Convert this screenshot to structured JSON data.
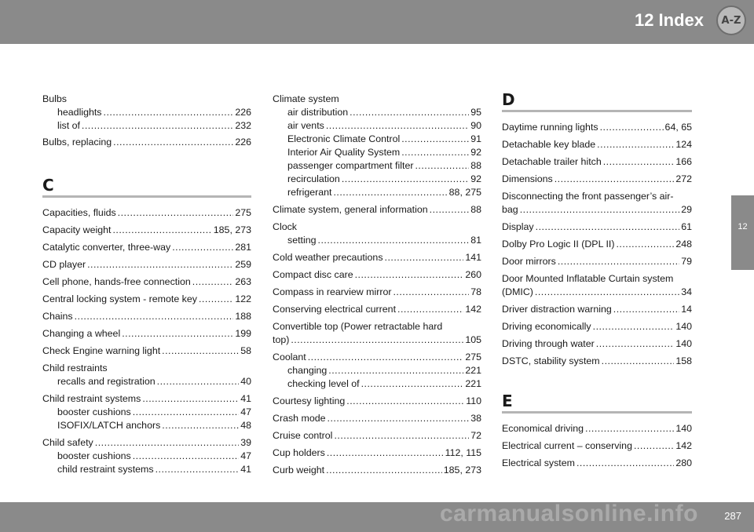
{
  "header": {
    "title": "12 Index",
    "badge": "A-Z"
  },
  "side_tab": "12",
  "footer": {
    "page_number": "287",
    "watermark": "carmanualsonline.info"
  },
  "columns": {
    "col1": {
      "bulbs": {
        "title": "Bulbs",
        "subs": [
          {
            "term": "headlights",
            "pages": "226"
          },
          {
            "term": "list of",
            "pages": "232"
          }
        ]
      },
      "bulbs_replacing": {
        "term": "Bulbs, replacing",
        "pages": "226"
      },
      "letter_c": "C",
      "entries": [
        {
          "term": "Capacities, fluids",
          "pages": "275"
        },
        {
          "term": "Capacity weight",
          "pages": "185, 273"
        },
        {
          "term": "Catalytic converter, three-way",
          "pages": "281"
        },
        {
          "term": "CD player",
          "pages": "259"
        },
        {
          "term": "Cell phone, hands-free connection",
          "pages": "263"
        },
        {
          "term": "Central locking system - remote key",
          "pages": "122"
        },
        {
          "term": "Chains",
          "pages": "188"
        },
        {
          "term": "Changing a wheel",
          "pages": "199"
        },
        {
          "term": "Check Engine warning light",
          "pages": "58"
        }
      ],
      "child_restraints": {
        "title": "Child restraints",
        "subs": [
          {
            "term": "recalls and registration",
            "pages": "40"
          }
        ]
      },
      "child_restraint_systems": {
        "term": "Child restraint systems",
        "pages": "41",
        "subs": [
          {
            "term": "booster cushions",
            "pages": "47"
          },
          {
            "term": "ISOFIX/LATCH anchors",
            "pages": "48"
          }
        ]
      },
      "child_safety": {
        "term": "Child safety",
        "pages": "39",
        "subs": [
          {
            "term": "booster cushions",
            "pages": "47"
          },
          {
            "term": "child restraint systems",
            "pages": "41"
          }
        ]
      }
    },
    "col2": {
      "climate_system": {
        "title": "Climate system",
        "subs": [
          {
            "term": "air distribution",
            "pages": "95"
          },
          {
            "term": "air vents",
            "pages": "90"
          },
          {
            "term": "Electronic Climate Control",
            "pages": "91"
          },
          {
            "term": "Interior Air Quality System",
            "pages": "92"
          },
          {
            "term": "passenger compartment filter",
            "pages": "88"
          },
          {
            "term": "recirculation",
            "pages": "92"
          },
          {
            "term": "refrigerant",
            "pages": "88, 275"
          }
        ]
      },
      "climate_general": {
        "term": "Climate system, general information",
        "pages": "88"
      },
      "clock": {
        "title": "Clock",
        "subs": [
          {
            "term": "setting",
            "pages": "81"
          }
        ]
      },
      "entries_a": [
        {
          "term": "Cold weather precautions",
          "pages": "141"
        },
        {
          "term": "Compact disc care",
          "pages": "260"
        },
        {
          "term": "Compass in rearview mirror",
          "pages": "78"
        },
        {
          "term": "Conserving electrical current",
          "pages": "142"
        }
      ],
      "convertible_top": {
        "line1": "Convertible top (Power retractable hard",
        "term": "top)",
        "pages": "105"
      },
      "coolant": {
        "term": "Coolant",
        "pages": "275",
        "subs": [
          {
            "term": "changing",
            "pages": "221"
          },
          {
            "term": "checking level of",
            "pages": "221"
          }
        ]
      },
      "entries_b": [
        {
          "term": "Courtesy lighting",
          "pages": "110"
        },
        {
          "term": "Crash mode",
          "pages": "38"
        },
        {
          "term": "Cruise control",
          "pages": "72"
        },
        {
          "term": "Cup holders",
          "pages": "112, 115"
        },
        {
          "term": "Curb weight",
          "pages": "185, 273"
        }
      ]
    },
    "col3": {
      "letter_d": "D",
      "entries_d1": [
        {
          "term": "Daytime running lights",
          "pages": "64, 65"
        },
        {
          "term": "Detachable key blade",
          "pages": "124"
        },
        {
          "term": "Detachable trailer hitch",
          "pages": "166"
        },
        {
          "term": "Dimensions",
          "pages": "272"
        }
      ],
      "disconnecting": {
        "line1": "Disconnecting the front passenger’s air-",
        "term": "bag",
        "pages": "29"
      },
      "entries_d2": [
        {
          "term": "Display",
          "pages": "61"
        },
        {
          "term": "Dolby Pro Logic II (DPL II)",
          "pages": "248"
        },
        {
          "term": "Door mirrors",
          "pages": "79"
        }
      ],
      "dmic": {
        "line1": "Door Mounted Inflatable Curtain system",
        "term": "(DMIC)",
        "pages": "34"
      },
      "entries_d3": [
        {
          "term": "Driver distraction warning",
          "pages": "14"
        },
        {
          "term": "Driving economically",
          "pages": "140"
        },
        {
          "term": "Driving through water",
          "pages": "140"
        },
        {
          "term": "DSTC, stability system",
          "pages": "158"
        }
      ],
      "letter_e": "E",
      "entries_e": [
        {
          "term": "Economical driving",
          "pages": "140"
        },
        {
          "term": "Electrical current – conserving",
          "pages": "142"
        },
        {
          "term": "Electrical system",
          "pages": "280"
        }
      ]
    }
  }
}
